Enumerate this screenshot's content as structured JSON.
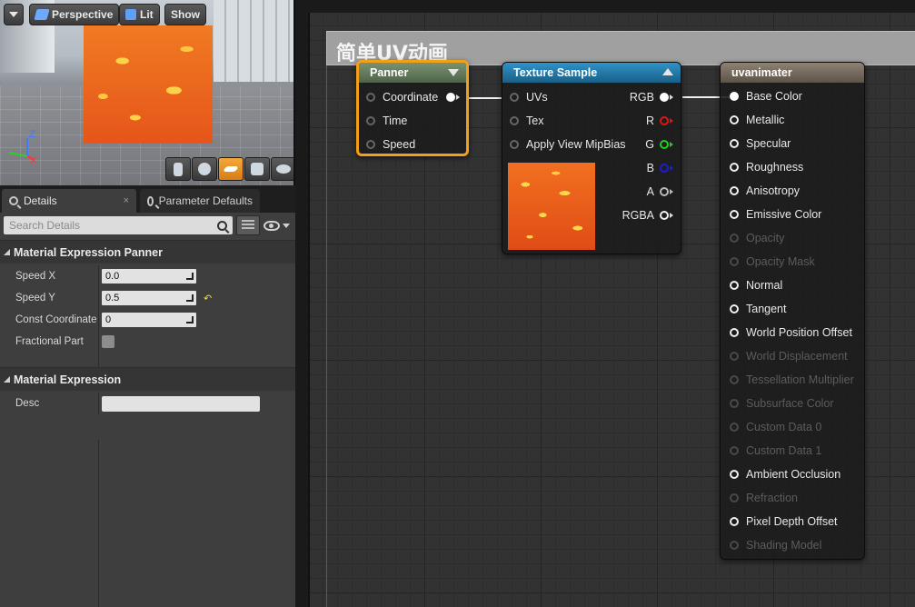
{
  "viewport": {
    "menu_icon": "chevron-down-icon",
    "perspective_label": "Perspective",
    "lit_label": "Lit",
    "show_label": "Show",
    "axis_z": "Z",
    "axis_x": "X",
    "preview_tools": [
      "cylinder-icon",
      "sphere-icon",
      "plane-icon",
      "cube-icon",
      "custom-mesh-icon"
    ]
  },
  "details": {
    "tab_details": "Details",
    "tab_details_close": "×",
    "tab_params": "Parameter Defaults",
    "search_placeholder": "Search Details",
    "categories": [
      {
        "title": "Material Expression Panner",
        "props": [
          {
            "label": "Speed X",
            "value": "0.0"
          },
          {
            "label": "Speed Y",
            "value": "0.5",
            "reset": "↶"
          },
          {
            "label": "Const Coordinate",
            "value": "0"
          },
          {
            "label": "Fractional Part",
            "checkbox": false
          }
        ]
      },
      {
        "title": "Material Expression",
        "props": [
          {
            "label": "Desc",
            "value": ""
          }
        ]
      }
    ]
  },
  "graph": {
    "comment_title": "简单UV动画",
    "panner": {
      "title": "Panner",
      "inputs": [
        "Coordinate",
        "Time",
        "Speed"
      ]
    },
    "texture_sample": {
      "title": "Texture Sample",
      "inputs": [
        "UVs",
        "Tex",
        "Apply View MipBias"
      ],
      "outputs": [
        "RGB",
        "R",
        "G",
        "B",
        "A",
        "RGBA"
      ]
    },
    "material": {
      "title": "uvanimater",
      "inputs": [
        {
          "label": "Base Color",
          "enabled": true,
          "connected": true
        },
        {
          "label": "Metallic",
          "enabled": true
        },
        {
          "label": "Specular",
          "enabled": true
        },
        {
          "label": "Roughness",
          "enabled": true
        },
        {
          "label": "Anisotropy",
          "enabled": true
        },
        {
          "label": "Emissive Color",
          "enabled": true
        },
        {
          "label": "Opacity",
          "enabled": false
        },
        {
          "label": "Opacity Mask",
          "enabled": false
        },
        {
          "label": "Normal",
          "enabled": true
        },
        {
          "label": "Tangent",
          "enabled": true
        },
        {
          "label": "World Position Offset",
          "enabled": true
        },
        {
          "label": "World Displacement",
          "enabled": false
        },
        {
          "label": "Tessellation Multiplier",
          "enabled": false
        },
        {
          "label": "Subsurface Color",
          "enabled": false
        },
        {
          "label": "Custom Data 0",
          "enabled": false
        },
        {
          "label": "Custom Data 1",
          "enabled": false
        },
        {
          "label": "Ambient Occlusion",
          "enabled": true
        },
        {
          "label": "Refraction",
          "enabled": false
        },
        {
          "label": "Pixel Depth Offset",
          "enabled": true
        },
        {
          "label": "Shading Model",
          "enabled": false
        }
      ]
    }
  }
}
